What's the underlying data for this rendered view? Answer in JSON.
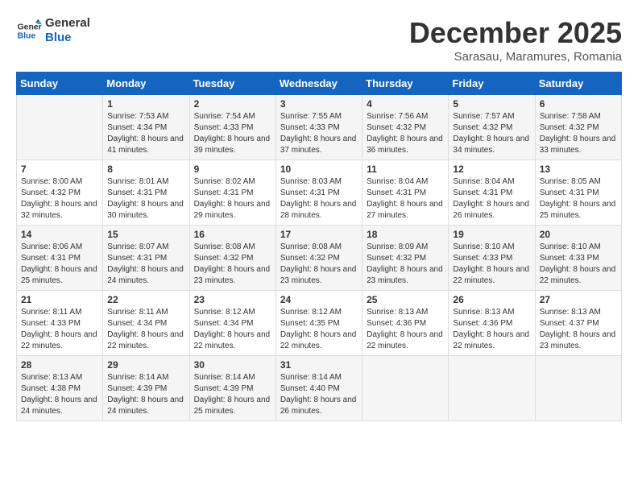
{
  "logo": {
    "line1": "General",
    "line2": "Blue"
  },
  "title": "December 2025",
  "subtitle": "Sarasau, Maramures, Romania",
  "weekdays": [
    "Sunday",
    "Monday",
    "Tuesday",
    "Wednesday",
    "Thursday",
    "Friday",
    "Saturday"
  ],
  "weeks": [
    [
      {
        "day": "",
        "sunrise": "",
        "sunset": "",
        "daylight": ""
      },
      {
        "day": "1",
        "sunrise": "Sunrise: 7:53 AM",
        "sunset": "Sunset: 4:34 PM",
        "daylight": "Daylight: 8 hours and 41 minutes."
      },
      {
        "day": "2",
        "sunrise": "Sunrise: 7:54 AM",
        "sunset": "Sunset: 4:33 PM",
        "daylight": "Daylight: 8 hours and 39 minutes."
      },
      {
        "day": "3",
        "sunrise": "Sunrise: 7:55 AM",
        "sunset": "Sunset: 4:33 PM",
        "daylight": "Daylight: 8 hours and 37 minutes."
      },
      {
        "day": "4",
        "sunrise": "Sunrise: 7:56 AM",
        "sunset": "Sunset: 4:32 PM",
        "daylight": "Daylight: 8 hours and 36 minutes."
      },
      {
        "day": "5",
        "sunrise": "Sunrise: 7:57 AM",
        "sunset": "Sunset: 4:32 PM",
        "daylight": "Daylight: 8 hours and 34 minutes."
      },
      {
        "day": "6",
        "sunrise": "Sunrise: 7:58 AM",
        "sunset": "Sunset: 4:32 PM",
        "daylight": "Daylight: 8 hours and 33 minutes."
      }
    ],
    [
      {
        "day": "7",
        "sunrise": "Sunrise: 8:00 AM",
        "sunset": "Sunset: 4:32 PM",
        "daylight": "Daylight: 8 hours and 32 minutes."
      },
      {
        "day": "8",
        "sunrise": "Sunrise: 8:01 AM",
        "sunset": "Sunset: 4:31 PM",
        "daylight": "Daylight: 8 hours and 30 minutes."
      },
      {
        "day": "9",
        "sunrise": "Sunrise: 8:02 AM",
        "sunset": "Sunset: 4:31 PM",
        "daylight": "Daylight: 8 hours and 29 minutes."
      },
      {
        "day": "10",
        "sunrise": "Sunrise: 8:03 AM",
        "sunset": "Sunset: 4:31 PM",
        "daylight": "Daylight: 8 hours and 28 minutes."
      },
      {
        "day": "11",
        "sunrise": "Sunrise: 8:04 AM",
        "sunset": "Sunset: 4:31 PM",
        "daylight": "Daylight: 8 hours and 27 minutes."
      },
      {
        "day": "12",
        "sunrise": "Sunrise: 8:04 AM",
        "sunset": "Sunset: 4:31 PM",
        "daylight": "Daylight: 8 hours and 26 minutes."
      },
      {
        "day": "13",
        "sunrise": "Sunrise: 8:05 AM",
        "sunset": "Sunset: 4:31 PM",
        "daylight": "Daylight: 8 hours and 25 minutes."
      }
    ],
    [
      {
        "day": "14",
        "sunrise": "Sunrise: 8:06 AM",
        "sunset": "Sunset: 4:31 PM",
        "daylight": "Daylight: 8 hours and 25 minutes."
      },
      {
        "day": "15",
        "sunrise": "Sunrise: 8:07 AM",
        "sunset": "Sunset: 4:31 PM",
        "daylight": "Daylight: 8 hours and 24 minutes."
      },
      {
        "day": "16",
        "sunrise": "Sunrise: 8:08 AM",
        "sunset": "Sunset: 4:32 PM",
        "daylight": "Daylight: 8 hours and 23 minutes."
      },
      {
        "day": "17",
        "sunrise": "Sunrise: 8:08 AM",
        "sunset": "Sunset: 4:32 PM",
        "daylight": "Daylight: 8 hours and 23 minutes."
      },
      {
        "day": "18",
        "sunrise": "Sunrise: 8:09 AM",
        "sunset": "Sunset: 4:32 PM",
        "daylight": "Daylight: 8 hours and 23 minutes."
      },
      {
        "day": "19",
        "sunrise": "Sunrise: 8:10 AM",
        "sunset": "Sunset: 4:33 PM",
        "daylight": "Daylight: 8 hours and 22 minutes."
      },
      {
        "day": "20",
        "sunrise": "Sunrise: 8:10 AM",
        "sunset": "Sunset: 4:33 PM",
        "daylight": "Daylight: 8 hours and 22 minutes."
      }
    ],
    [
      {
        "day": "21",
        "sunrise": "Sunrise: 8:11 AM",
        "sunset": "Sunset: 4:33 PM",
        "daylight": "Daylight: 8 hours and 22 minutes."
      },
      {
        "day": "22",
        "sunrise": "Sunrise: 8:11 AM",
        "sunset": "Sunset: 4:34 PM",
        "daylight": "Daylight: 8 hours and 22 minutes."
      },
      {
        "day": "23",
        "sunrise": "Sunrise: 8:12 AM",
        "sunset": "Sunset: 4:34 PM",
        "daylight": "Daylight: 8 hours and 22 minutes."
      },
      {
        "day": "24",
        "sunrise": "Sunrise: 8:12 AM",
        "sunset": "Sunset: 4:35 PM",
        "daylight": "Daylight: 8 hours and 22 minutes."
      },
      {
        "day": "25",
        "sunrise": "Sunrise: 8:13 AM",
        "sunset": "Sunset: 4:36 PM",
        "daylight": "Daylight: 8 hours and 22 minutes."
      },
      {
        "day": "26",
        "sunrise": "Sunrise: 8:13 AM",
        "sunset": "Sunset: 4:36 PM",
        "daylight": "Daylight: 8 hours and 22 minutes."
      },
      {
        "day": "27",
        "sunrise": "Sunrise: 8:13 AM",
        "sunset": "Sunset: 4:37 PM",
        "daylight": "Daylight: 8 hours and 23 minutes."
      }
    ],
    [
      {
        "day": "28",
        "sunrise": "Sunrise: 8:13 AM",
        "sunset": "Sunset: 4:38 PM",
        "daylight": "Daylight: 8 hours and 24 minutes."
      },
      {
        "day": "29",
        "sunrise": "Sunrise: 8:14 AM",
        "sunset": "Sunset: 4:39 PM",
        "daylight": "Daylight: 8 hours and 24 minutes."
      },
      {
        "day": "30",
        "sunrise": "Sunrise: 8:14 AM",
        "sunset": "Sunset: 4:39 PM",
        "daylight": "Daylight: 8 hours and 25 minutes."
      },
      {
        "day": "31",
        "sunrise": "Sunrise: 8:14 AM",
        "sunset": "Sunset: 4:40 PM",
        "daylight": "Daylight: 8 hours and 26 minutes."
      },
      {
        "day": "",
        "sunrise": "",
        "sunset": "",
        "daylight": ""
      },
      {
        "day": "",
        "sunrise": "",
        "sunset": "",
        "daylight": ""
      },
      {
        "day": "",
        "sunrise": "",
        "sunset": "",
        "daylight": ""
      }
    ]
  ]
}
